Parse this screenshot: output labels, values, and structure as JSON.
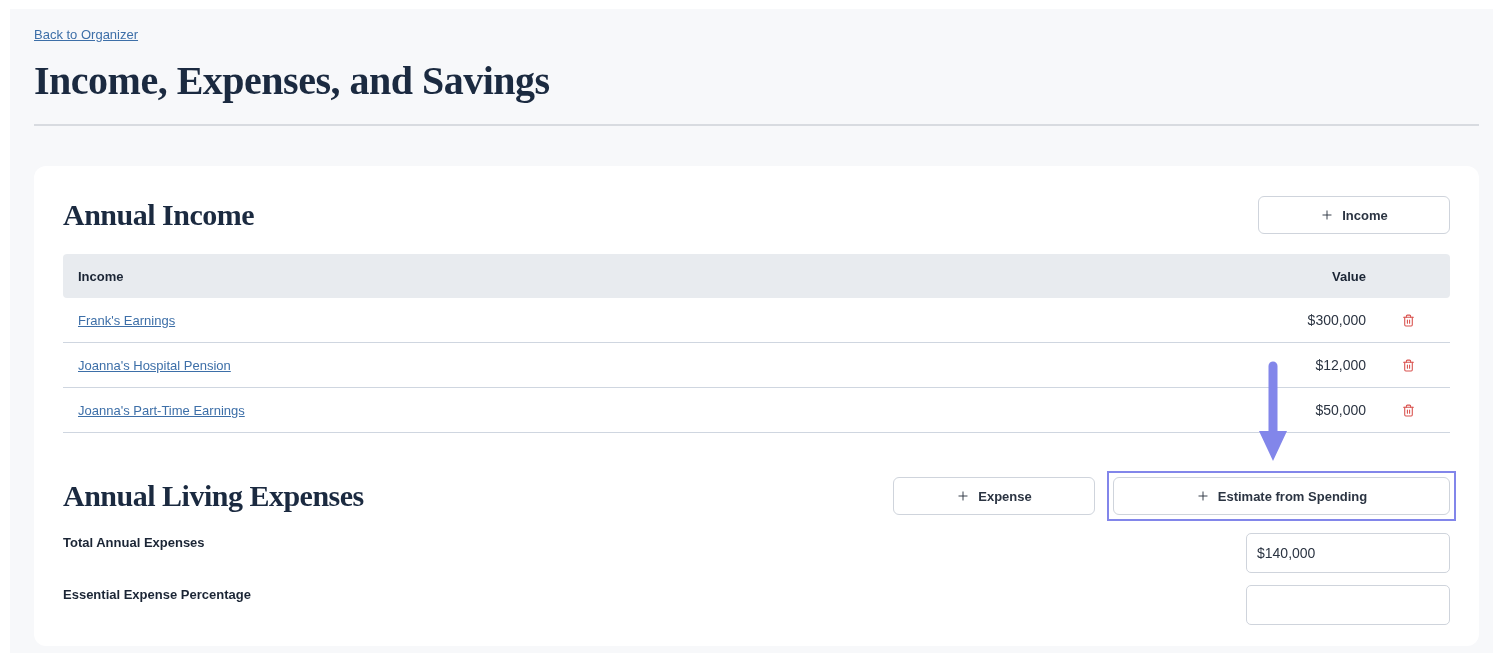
{
  "back_link": "Back to Organizer",
  "title": "Income, Expenses, and Savings",
  "income": {
    "heading": "Annual Income",
    "add_button": "Income",
    "columns": [
      "Income",
      "Value"
    ],
    "rows": [
      {
        "name": "Frank's Earnings",
        "value": "$300,000"
      },
      {
        "name": "Joanna's Hospital Pension",
        "value": "$12,000"
      },
      {
        "name": "Joanna's Part-Time Earnings",
        "value": "$50,000"
      }
    ]
  },
  "expenses": {
    "heading": "Annual Living Expenses",
    "buttons": [
      {
        "label": "Expense",
        "highlighted": false
      },
      {
        "label": "Estimate from Spending",
        "highlighted": true
      }
    ],
    "fields": [
      {
        "label": "Total Annual Expenses",
        "value": "$140,000"
      },
      {
        "label": "Essential Expense Percentage"
      }
    ]
  }
}
